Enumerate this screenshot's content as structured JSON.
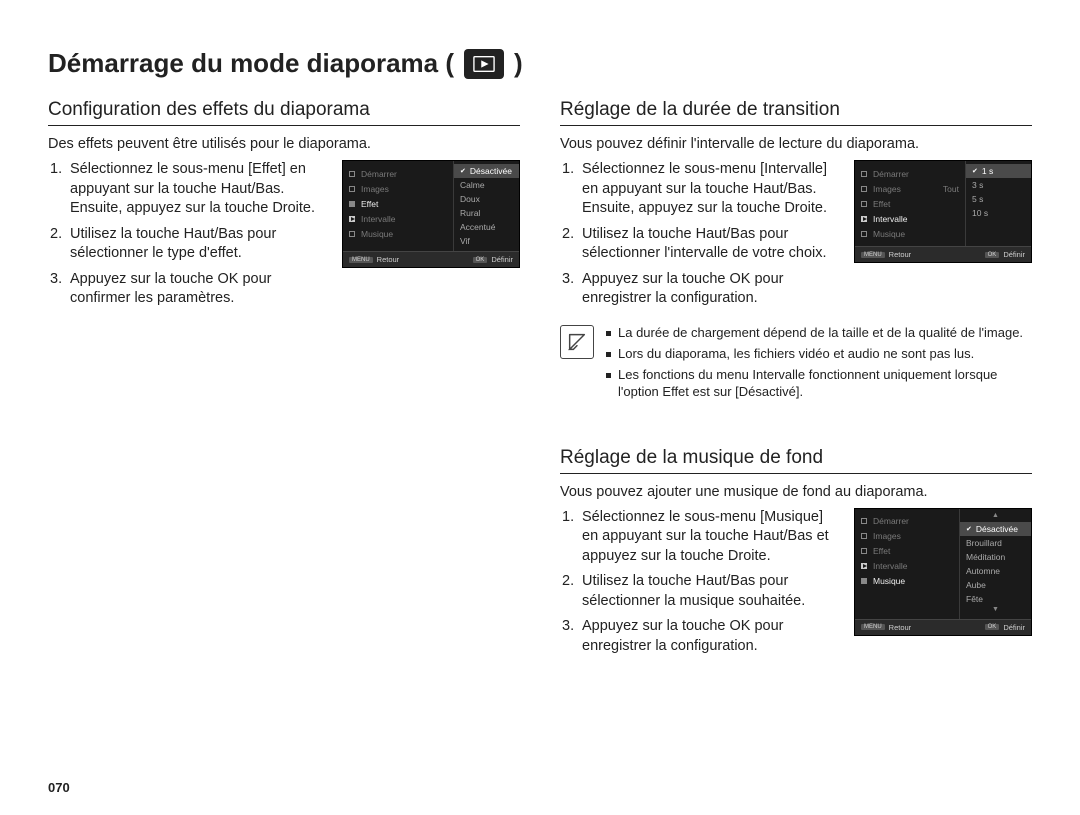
{
  "title": "Démarrage du mode diaporama (",
  "title_trail": ")",
  "page_number": "070",
  "left": {
    "section": "Configuration des effets du diaporama",
    "intro": "Des effets peuvent être utilisés pour le diaporama.",
    "steps": [
      "Sélectionnez le sous-menu [Effet] en appuyant sur la touche Haut/Bas. Ensuite, appuyez sur la touche Droite.",
      "Utilisez la touche Haut/Bas pour sélectionner le type d'effet.",
      "Appuyez sur la touche OK pour confirmer les paramètres."
    ],
    "menu": {
      "left_items": [
        "Démarrer",
        "Images",
        "Effet",
        "Intervalle",
        "Musique"
      ],
      "active_index": 2,
      "options": [
        "Désactivée",
        "Calme",
        "Doux",
        "Rural",
        "Accentué",
        "Vif"
      ],
      "selected_index": 0,
      "foot_left_btn": "MENU",
      "foot_left": "Retour",
      "foot_right_btn": "OK",
      "foot_right": "Définir"
    }
  },
  "right_top": {
    "section": "Réglage de la durée de transition",
    "intro": "Vous pouvez définir l'intervalle de lecture du diaporama.",
    "steps": [
      "Sélectionnez le sous-menu [Intervalle] en appuyant sur la touche Haut/Bas. Ensuite, appuyez sur la touche Droite.",
      "Utilisez la touche Haut/Bas pour sélectionner l'intervalle de votre choix.",
      "Appuyez sur la touche OK pour enregistrer la configuration."
    ],
    "menu": {
      "left_items": [
        "Démarrer",
        "Images",
        "Effet",
        "Intervalle",
        "Musique"
      ],
      "active_index": 3,
      "right_label": "Tout",
      "options": [
        "1 s",
        "3 s",
        "5 s",
        "10 s"
      ],
      "selected_index": 0,
      "foot_left_btn": "MENU",
      "foot_left": "Retour",
      "foot_right_btn": "OK",
      "foot_right": "Définir"
    },
    "notes": [
      "La durée de chargement dépend de la taille et de la qualité de l'image.",
      "Lors du diaporama, les fichiers vidéo et audio ne sont pas lus.",
      "Les fonctions du menu Intervalle fonctionnent uniquement lorsque l'option Effet est sur [Désactivé]."
    ]
  },
  "right_bottom": {
    "section": "Réglage de la musique de fond",
    "intro": "Vous pouvez ajouter une musique de fond au diaporama.",
    "steps": [
      "Sélectionnez le sous-menu [Musique] en appuyant sur la touche Haut/Bas et appuyez sur la touche Droite.",
      "Utilisez la touche Haut/Bas pour sélectionner la musique souhaitée.",
      "Appuyez sur la touche OK pour enregistrer la configuration."
    ],
    "menu": {
      "left_items": [
        "Démarrer",
        "Images",
        "Effet",
        "Intervalle",
        "Musique"
      ],
      "active_index": 4,
      "arrows": true,
      "options": [
        "Désactivée",
        "Brouillard",
        "Méditation",
        "Automne",
        "Aube",
        "Fête"
      ],
      "selected_index": 0,
      "foot_left_btn": "MENU",
      "foot_left": "Retour",
      "foot_right_btn": "OK",
      "foot_right": "Définir"
    }
  }
}
